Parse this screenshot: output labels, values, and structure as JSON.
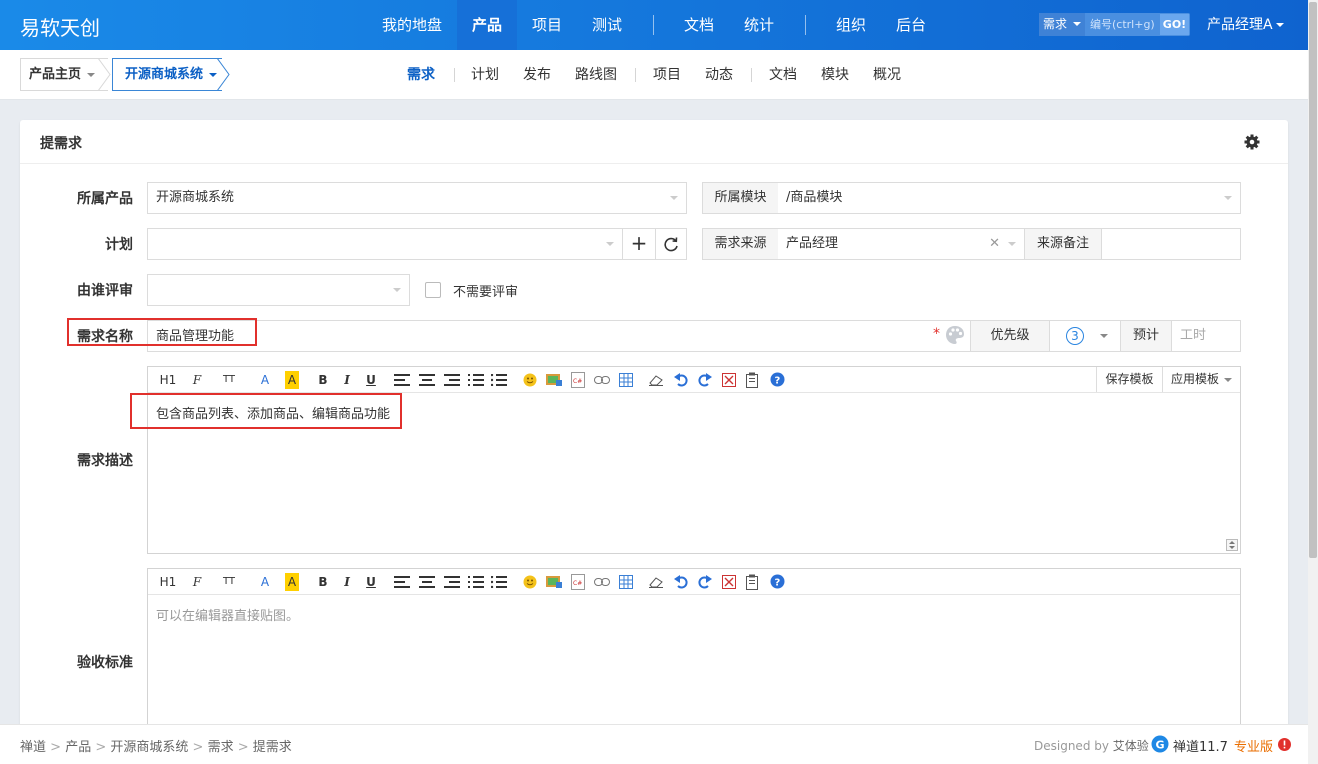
{
  "brand": "易软天创",
  "main_nav": [
    {
      "label": "我的地盘"
    },
    {
      "label": "产品"
    },
    {
      "label": "项目"
    },
    {
      "label": "测试"
    },
    {
      "label": "文档"
    },
    {
      "label": "统计"
    },
    {
      "label": "组织"
    },
    {
      "label": "后台"
    }
  ],
  "search": {
    "type": "需求",
    "placeholder": "编号(ctrl+g)",
    "go": "GO!"
  },
  "user": "产品经理A",
  "breadcrumb": {
    "home": "产品主页",
    "product": "开源商城系统"
  },
  "sub_nav": [
    {
      "label": "需求"
    },
    {
      "label": "计划"
    },
    {
      "label": "发布"
    },
    {
      "label": "路线图"
    },
    {
      "label": "项目"
    },
    {
      "label": "动态"
    },
    {
      "label": "文档"
    },
    {
      "label": "模块"
    },
    {
      "label": "概况"
    }
  ],
  "panel": {
    "title": "提需求"
  },
  "form": {
    "product_label": "所属产品",
    "product_value": "开源商城系统",
    "module_label": "所属模块",
    "module_value": "/商品模块",
    "plan_label": "计划",
    "source_label": "需求来源",
    "source_value": "产品经理",
    "source_note_label": "来源备注",
    "reviewer_label": "由谁评审",
    "no_review_label": "不需要评审",
    "title_label": "需求名称",
    "title_value": "商品管理功能",
    "required_mark": "*",
    "priority_label": "优先级",
    "priority_value": "3",
    "estimate_label": "预计",
    "estimate_placeholder": "工时",
    "desc_label": "需求描述",
    "desc_value": "包含商品列表、添加商品、编辑商品功能",
    "verify_label": "验收标准",
    "verify_placeholder": "可以在编辑器直接贴图。"
  },
  "editor_toolbar": {
    "heading": "H1",
    "font": "F",
    "size": "TT",
    "font_color": "A",
    "bg_color": "A",
    "bold": "B",
    "italic": "I",
    "underline": "U",
    "save_template": "保存模板",
    "apply_template": "应用模板"
  },
  "footer": {
    "breadcrumb": [
      "禅道",
      "产品",
      "开源商城系统",
      "需求",
      "提需求"
    ],
    "designed_by": "Designed by",
    "designer": "艾体验",
    "version": "禅道11.7",
    "edition": "专业版"
  },
  "colors": {
    "topbar": "#1a8ae8",
    "accent": "#0c60c5",
    "highlight_border": "#e1302c",
    "edition": "#ea6e00"
  }
}
